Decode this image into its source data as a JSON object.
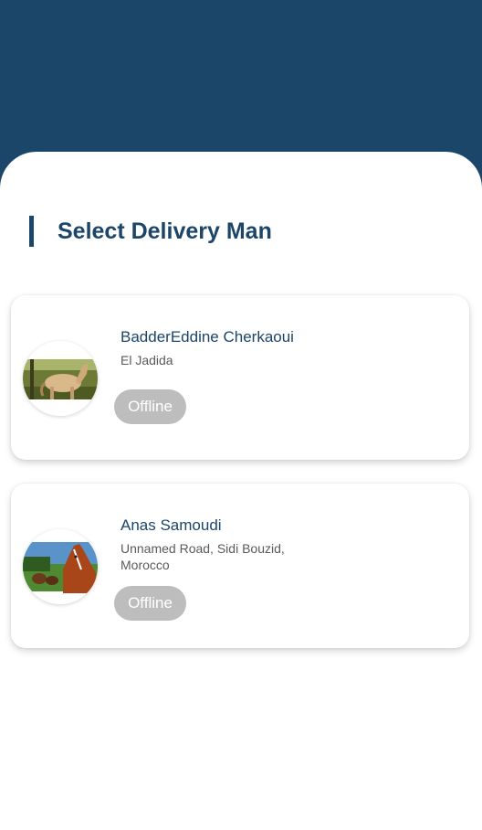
{
  "page": {
    "title": "Select Delivery Man"
  },
  "delivery_men": [
    {
      "name": "BadderEddine Cherkaoui",
      "address": "El Jadida",
      "status": "Offline",
      "avatar_icon": "horse-photo"
    },
    {
      "name": "Anas Samoudi",
      "address": "Unnamed Road, Sidi Bouzid, Morocco",
      "status": "Offline",
      "avatar_icon": "horse-photo"
    }
  ],
  "colors": {
    "primary": "#1b4569",
    "status_offline": "#bdbdbd",
    "background": "#ffffff"
  }
}
